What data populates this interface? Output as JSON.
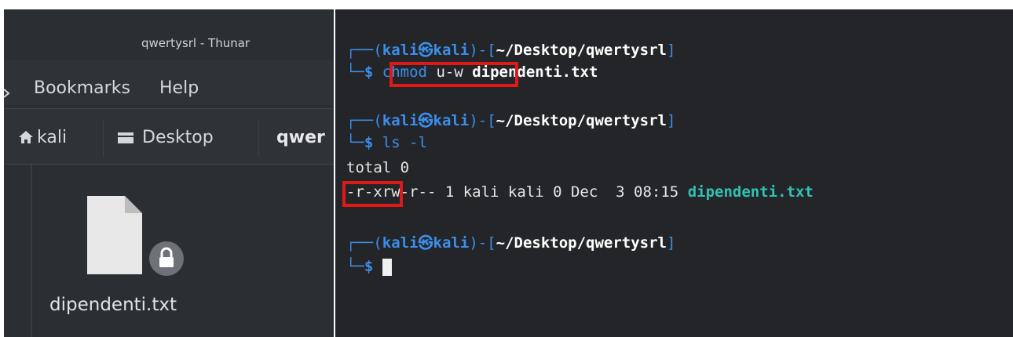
{
  "thunar": {
    "title": "qwertysrl - Thunar",
    "menu": {
      "bookmarks": "Bookmarks",
      "help": "Help"
    },
    "path": {
      "home": "kali",
      "desktop": "Desktop",
      "current": "qwer"
    },
    "file": {
      "name": "dipendenti.txt",
      "icon": "text-file-icon",
      "badge": "lock-icon"
    }
  },
  "terminal": {
    "prompt": {
      "open": "┌──(",
      "user": "kali",
      "at": "㉿",
      "host": "kali",
      "mid": ")-[",
      "path": "~/Desktop/qwertysrl",
      "close": "]",
      "corner": "└─",
      "dollar": "$"
    },
    "cmd1": {
      "command": "chmod",
      "args": "u-w",
      "file": "dipendenti.txt"
    },
    "cmd2": {
      "command": "ls",
      "args": "-l"
    },
    "output": {
      "total": "total 0",
      "line_meta": "-r-xrw-r-- 1 kali kali 0 Dec  3 08:15 ",
      "line_file": "dipendenti.txt"
    },
    "highlight_color": "#e01818",
    "accent": "#3b8eea",
    "file_color": "#2fc2b4"
  }
}
